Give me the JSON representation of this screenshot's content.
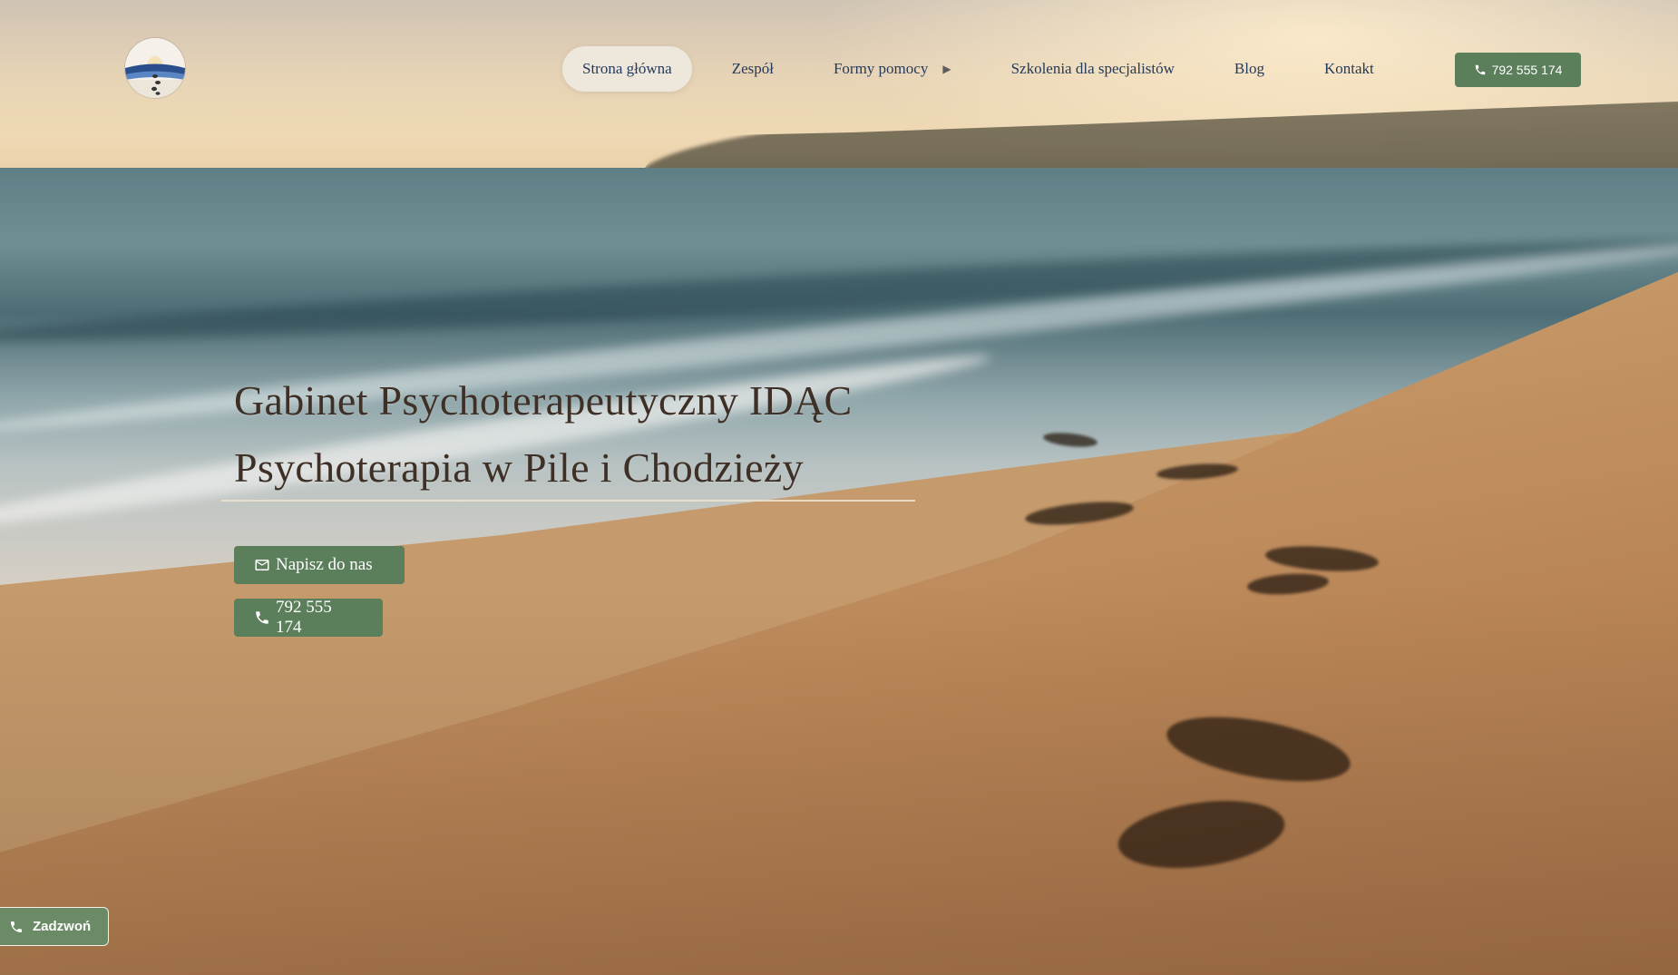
{
  "header": {
    "logo_name": "idac-logo",
    "nav": [
      {
        "label": "Strona główna",
        "active": true
      },
      {
        "label": "Zespół"
      },
      {
        "label": "Formy pomocy",
        "has_submenu": true
      },
      {
        "label": "Szkolenia dla specjalistów"
      },
      {
        "label": "Blog"
      },
      {
        "label": "Kontakt"
      }
    ],
    "phone_button": {
      "label": "792 555 174",
      "icon": "phone-icon"
    }
  },
  "hero": {
    "title_line1": "Gabinet Psychoterapeutyczny IDĄC",
    "title_line2": "Psychoterapia w Pile i Chodzieży",
    "buttons": [
      {
        "label": "Napisz do nas",
        "icon": "envelope-icon"
      },
      {
        "label": "792 555 174",
        "icon": "phone-icon"
      }
    ]
  },
  "floating_call": {
    "label": "Zadzwoń",
    "icon": "phone-icon"
  },
  "colors": {
    "accent_green": "#5c7f5b",
    "nav_text": "#243a5a",
    "title_text": "#3e3026"
  }
}
